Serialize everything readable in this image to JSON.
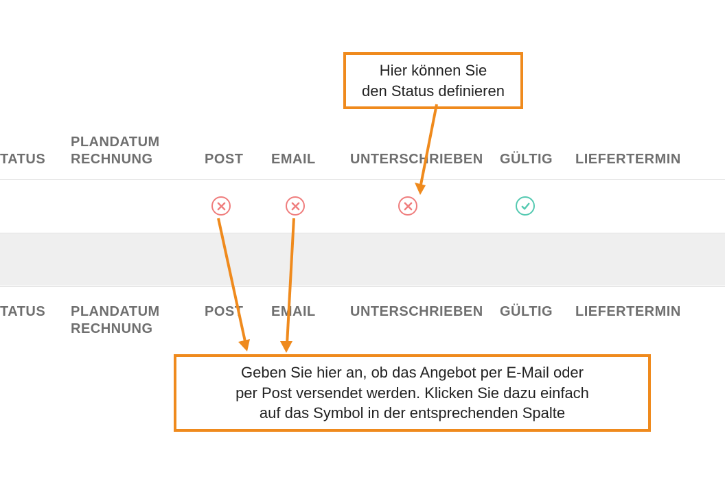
{
  "columns": {
    "status": "TATUS",
    "plandatum_line1": "PLANDATUM",
    "plandatum_line2": "RECHNUNG",
    "post": "POST",
    "email": "EMAIL",
    "unterschrieben": "UNTERSCHRIEBEN",
    "gueltig": "GÜLTIG",
    "liefertermin": "LIEFERTERMIN"
  },
  "footer_columns": {
    "status": "TATUS",
    "plandatum_line1": "PLANDATUM",
    "plandatum_line2": "RECHNUNG",
    "post": "POST",
    "email": "EMAIL",
    "unterschrieben": "UNTERSCHRIEBEN",
    "gueltig": "GÜLTIG",
    "liefertermin": "LIEFERTERMIN"
  },
  "row_status": {
    "post": "x",
    "email": "x",
    "unterschrieben": "x",
    "gueltig": "check"
  },
  "callouts": {
    "top_line1": "Hier können Sie",
    "top_line2": "den Status definieren",
    "bottom_line1": "Geben Sie hier an, ob das Angebot per E-Mail oder",
    "bottom_line2": "per Post versendet werden. Klicken Sie dazu einfach",
    "bottom_line3": "auf das Symbol in der entsprechenden Spalte"
  },
  "colors": {
    "accent": "#ef8a1d",
    "x_color": "#ef7d7d",
    "check_color": "#54c9b1",
    "header_text": "#6f6f6f"
  }
}
